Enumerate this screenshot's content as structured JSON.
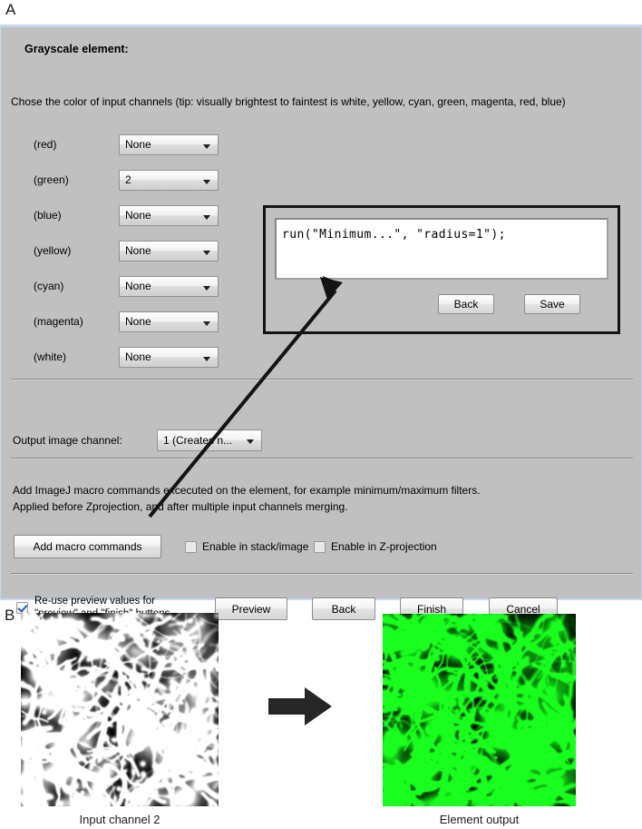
{
  "figure": {
    "panel_a_letter": "A",
    "panel_b_letter": "B"
  },
  "dialog": {
    "title": "Grayscale element:",
    "description": "Chose the color of input channels (tip: visually brightest to faintest is white, yellow, cyan, green, magenta, red, blue)",
    "channels": [
      {
        "label": "(red)",
        "value": "None"
      },
      {
        "label": "(green)",
        "value": "2"
      },
      {
        "label": "(blue)",
        "value": "None"
      },
      {
        "label": "(yellow)",
        "value": "None"
      },
      {
        "label": "(cyan)",
        "value": "None"
      },
      {
        "label": "(magenta)",
        "value": "None"
      },
      {
        "label": "(white)",
        "value": "None"
      }
    ],
    "output_channel": {
      "label": "Output image channel:",
      "value": "1 (Creates n..."
    },
    "macro_help": {
      "line1": "Add ImageJ macro commands excecuted on the element, for example minimum/maximum filters.",
      "line2": "Applied before Zprojection, and after multiple input channels merging."
    },
    "add_macro_button": "Add macro commands",
    "checkboxes": {
      "enable_stack": {
        "label": "Enable in stack/image",
        "checked": false
      },
      "enable_zproj": {
        "label": "Enable in Z-projection",
        "checked": false
      },
      "reuse_preview": {
        "line1": "Re-use preview values for",
        "line2": "\"preview\" and \"finish\" buttons.",
        "checked": true
      }
    },
    "buttons": {
      "preview": "Preview",
      "back": "Back",
      "finish": "Finish",
      "cancel": "Cancel"
    }
  },
  "macro_editor": {
    "code": "run(\"Minimum...\", \"radius=1\");",
    "back_button": "Back",
    "save_button": "Save"
  },
  "panel_b": {
    "left_caption": "Input channel 2",
    "right_caption": "Element output",
    "arrow": "right-arrow"
  },
  "colors": {
    "dialog_background": "#c0c0c0",
    "dialog_border": "#c3d7ee",
    "macro_panel_border": "#141414",
    "checkbox_check": "#2b5fb0",
    "green_channel": "#00c000",
    "text": "#000000"
  }
}
